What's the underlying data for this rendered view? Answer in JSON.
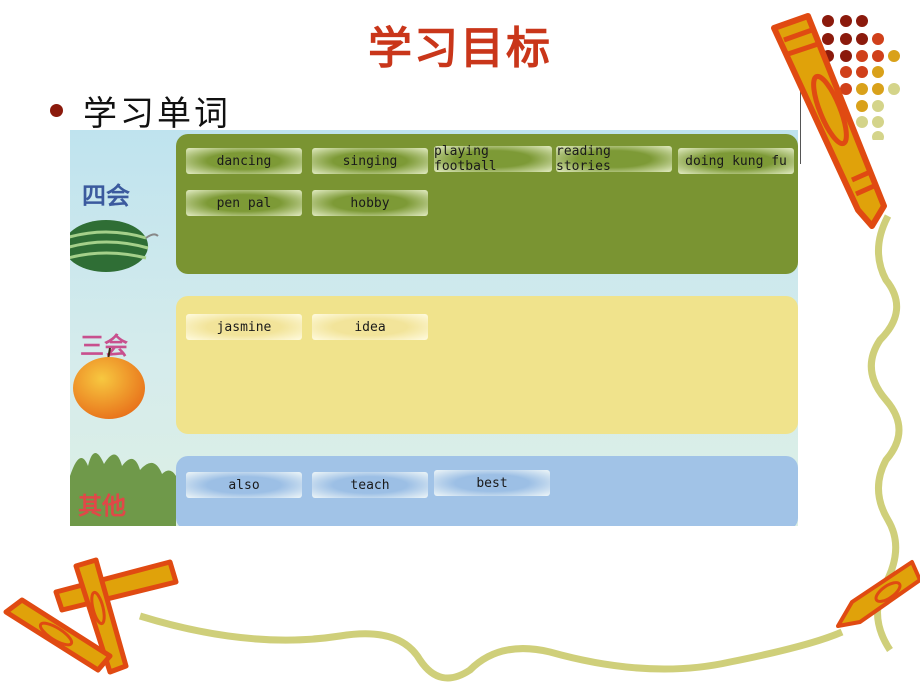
{
  "slide": {
    "title": "学习目标",
    "bullet": "学习单词"
  },
  "vocab": {
    "groups": [
      {
        "label": "四会",
        "label_color": "#3b5a9e",
        "icon": "watermelon-icon",
        "box_color": "#7a9432",
        "words": [
          "dancing",
          "singing",
          "playing football",
          "reading stories",
          "doing kung fu",
          "pen pal",
          "hobby"
        ]
      },
      {
        "label": "三会",
        "label_color": "#c8508e",
        "icon": "orange-fruit-icon",
        "box_color": "#f0e38c",
        "words": [
          "jasmine",
          "idea"
        ]
      },
      {
        "label": "其他",
        "label_color": "#e04848",
        "icon": "grass-icon",
        "box_color": "#a1c3e7",
        "words": [
          "also",
          "teach",
          "best"
        ]
      }
    ]
  },
  "colors": {
    "title": "#c9361a",
    "bullet": "#8b1a0c",
    "crayon_outline": "#e04a12",
    "crayon_fill": "#e0a20a",
    "squiggle": "#cfcf7a"
  }
}
